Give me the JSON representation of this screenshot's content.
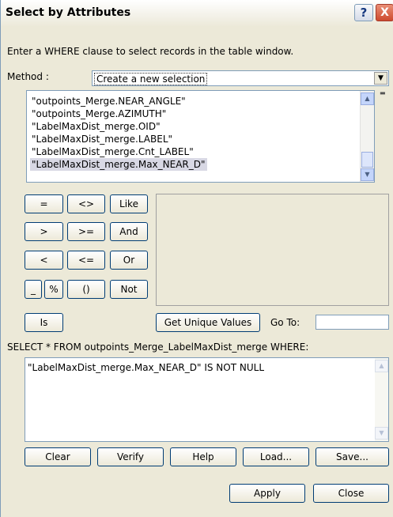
{
  "window": {
    "title": "Select by Attributes",
    "help_label": "?",
    "close_label": "X"
  },
  "instructions": "Enter a WHERE clause to select records in the table window.",
  "method": {
    "label": "Method :",
    "value": "Create a new selection"
  },
  "fields": [
    "\"outpoints_Merge.NEAR_ANGLE\"",
    "\"outpoints_Merge.AZIMUTH\"",
    "\"LabelMaxDist_merge.OID\"",
    "\"LabelMaxDist_merge.LABEL\"",
    "\"LabelMaxDist_merge.Cnt_LABEL\"",
    "\"LabelMaxDist_merge.Max_NEAR_D\""
  ],
  "operators": {
    "eq": "=",
    "ne": "<>",
    "like": "Like",
    "gt": ">",
    "ge": ">=",
    "and": "And",
    "lt": "<",
    "le": "<=",
    "or": "Or",
    "underscore": "_",
    "percent": "%",
    "parens": "()",
    "not": "Not",
    "is": "Is"
  },
  "get_unique_values": "Get Unique Values",
  "goto_label": "Go To:",
  "goto_value": "",
  "select_statement": "SELECT * FROM outpoints_Merge_LabelMaxDist_merge WHERE:",
  "where_clause": "\"LabelMaxDist_merge.Max_NEAR_D\" IS NOT NULL",
  "actions": {
    "clear": "Clear",
    "verify": "Verify",
    "help": "Help",
    "load": "Load...",
    "save": "Save..."
  },
  "footer": {
    "apply": "Apply",
    "close": "Close"
  }
}
